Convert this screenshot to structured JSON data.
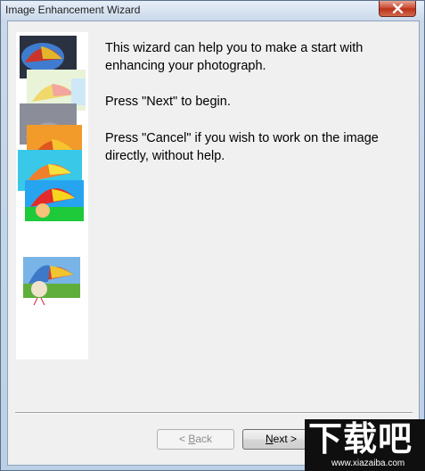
{
  "window": {
    "title": "Image Enhancement Wizard",
    "close_icon": "close-icon"
  },
  "content": {
    "intro": "This wizard can help you to make a start with enhancing your photograph.",
    "next_hint": "Press \"Next\" to begin.",
    "cancel_hint": "Press \"Cancel\" if you wish to work on the image directly, without help."
  },
  "buttons": {
    "back": {
      "prefix": "< ",
      "accel": "B",
      "rest": "ack",
      "enabled": false
    },
    "next": {
      "accel": "N",
      "rest": "ext >",
      "enabled": true
    }
  },
  "watermark": {
    "glyphs": "下载吧",
    "url": "www.xiazaiba.com"
  },
  "colors": {
    "client_bg": "#f0f0f0",
    "title_bg": "#cbd9ea",
    "close_red": "#c8442c"
  }
}
